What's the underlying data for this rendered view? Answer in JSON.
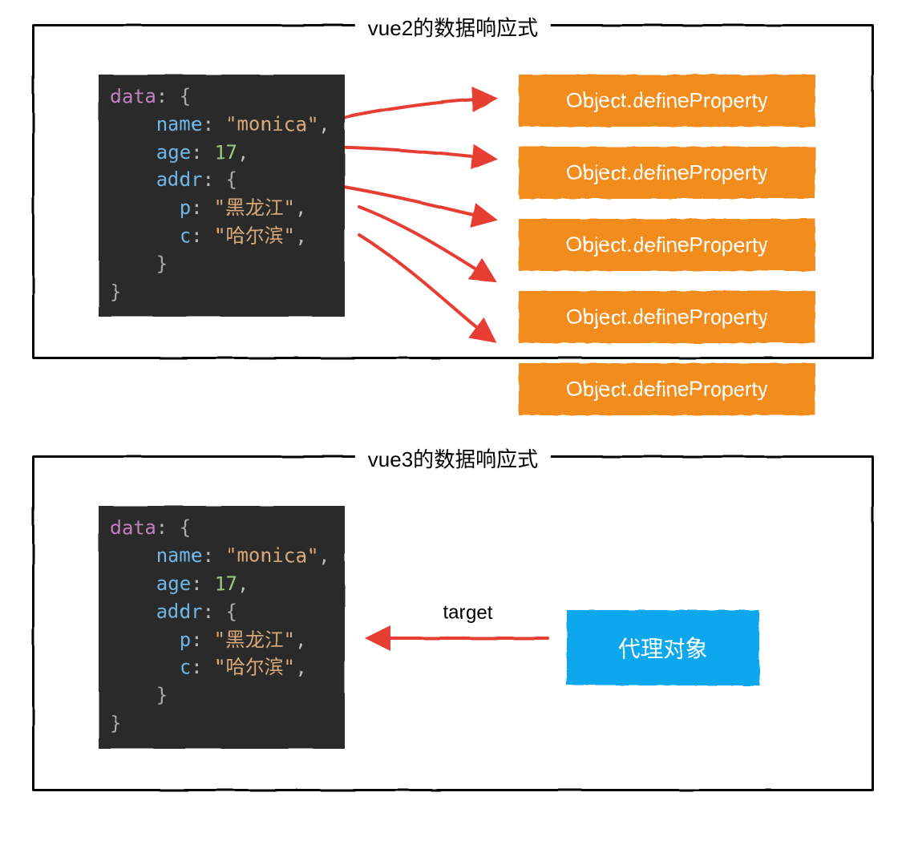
{
  "panel1": {
    "title": "vue2的数据响应式",
    "code": {
      "data_key": "data",
      "name_key": "name",
      "name_val": "\"monica\"",
      "age_key": "age",
      "age_val": "17",
      "addr_key": "addr",
      "p_key": "p",
      "p_val": "\"黑龙江\"",
      "c_key": "c",
      "c_val": "\"哈尔滨\""
    },
    "define_label": "Object.defineProperty"
  },
  "panel2": {
    "title": "vue3的数据响应式",
    "code": {
      "data_key": "data",
      "name_key": "name",
      "name_val": "\"monica\"",
      "age_key": "age",
      "age_val": "17",
      "addr_key": "addr",
      "p_key": "p",
      "p_val": "\"黑龙江\"",
      "c_key": "c",
      "c_val": "\"哈尔滨\""
    },
    "target_label": "target",
    "proxy_label": "代理对象"
  }
}
